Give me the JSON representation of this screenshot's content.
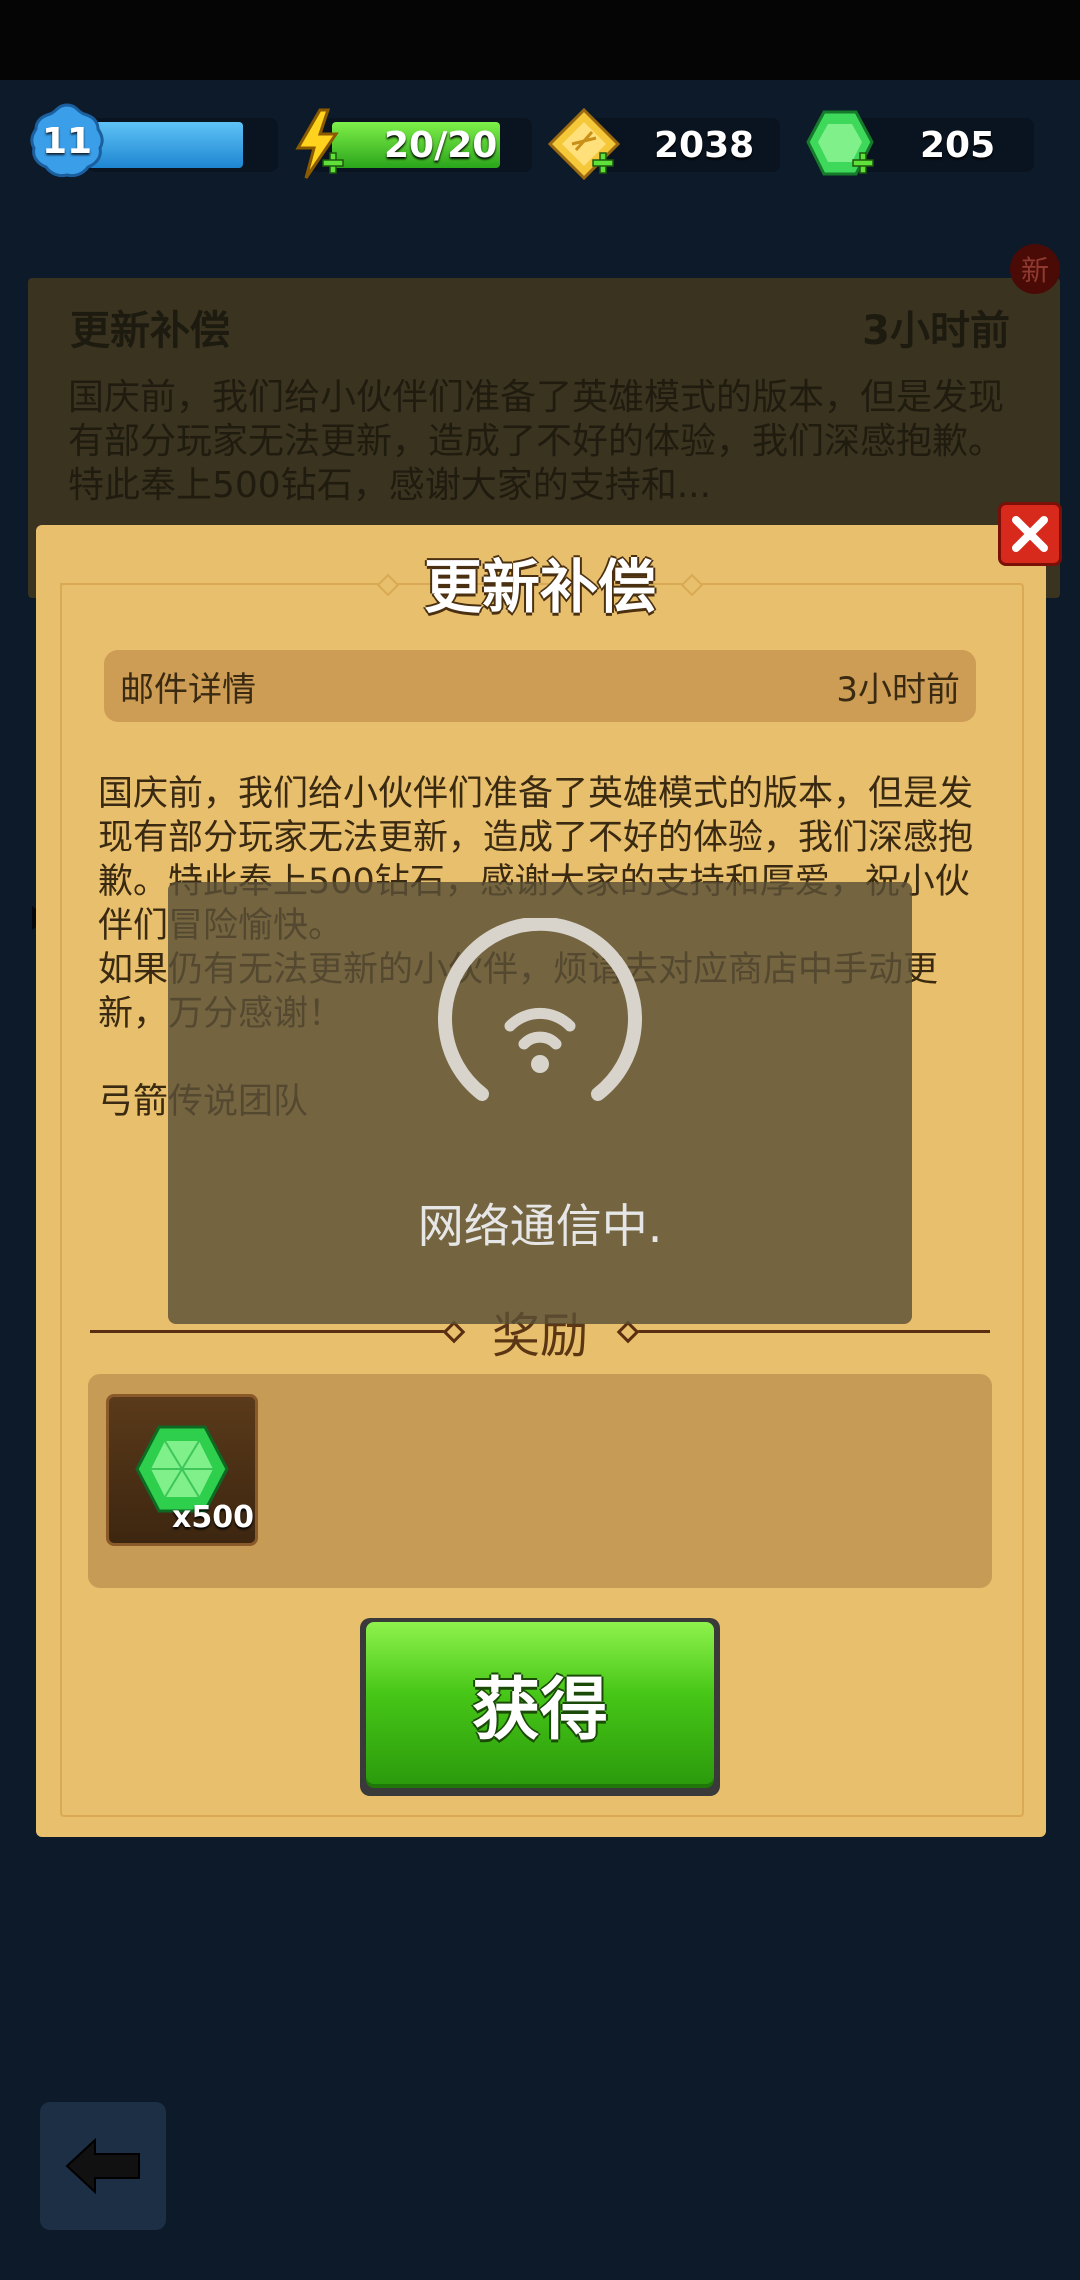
{
  "hud": {
    "level": "11",
    "energy": "20/20",
    "gold": "2038",
    "gems": "205"
  },
  "background_mail": {
    "title": "更新补偿",
    "time": "3小时前",
    "preview": "国庆前，我们给小伙伴们准备了英雄模式的版本，但是发现有部分玩家无法更新，造成了不好的体验，我们深感抱歉。特此奉上500钻石，感谢大家的支持和...",
    "new_badge": "新"
  },
  "dialog": {
    "title": "更新补偿",
    "header_label": "邮件详情",
    "header_time": "3小时前",
    "body": "国庆前，我们给小伙伴们准备了英雄模式的版本，但是发现有部分玩家无法更新，造成了不好的体验，我们深感抱歉。特此奉上500钻石，感谢大家的支持和厚爱，祝小伙伴们冒险愉快。\n如果仍有无法更新的小伙伴，烦请去对应商店中手动更新，万分感谢！\n\n弓箭传说团队",
    "reward_label": "奖励",
    "reward_qty": "x500",
    "get_button": "获得"
  },
  "loading": {
    "text": "网络通信中."
  },
  "icons": {
    "level": "level-badge-icon",
    "energy": "lightning-icon",
    "gold": "gold-coin-icon",
    "gem": "green-gem-icon",
    "close": "close-icon",
    "wifi": "wifi-icon",
    "back": "back-arrow-icon"
  },
  "colors": {
    "dialog_bg": "#e8bf6c",
    "button_green": "#46c617",
    "close_red": "#d82a1c"
  }
}
